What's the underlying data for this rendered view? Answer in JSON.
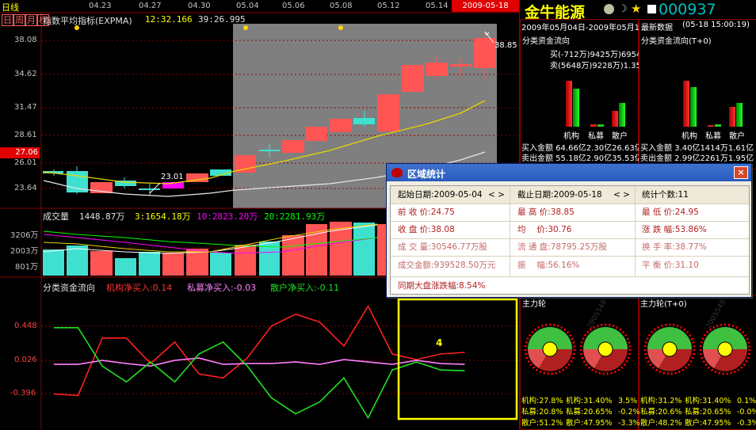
{
  "top_bar": {
    "period_tag": "日线",
    "period_tabs": [
      "日",
      "周",
      "月",
      "权"
    ],
    "dates": [
      "04.23",
      "04.27",
      "04.30",
      "05.04",
      "05.06",
      "05.08",
      "05.12",
      "05.14"
    ],
    "cursor_date": "2009-05-18",
    "indicator_label": "指数平均指标(EXPMA)",
    "indicator_val1": "12:32.166",
    "indicator_val2": "39:26.995"
  },
  "price_axis": [
    "38.08",
    "34.62",
    "31.47",
    "28.61",
    "26.01",
    "23.64"
  ],
  "price_current": "27.06",
  "price_high_label": "38.85",
  "price_low_label": "23.01",
  "volume": {
    "title": "成交量",
    "total": "1448.87万",
    "ma3": "3:1654.18万",
    "ma10": "10:2823.20万",
    "ma20": "20:2281.93万",
    "axis": [
      "3206万",
      "2003万",
      "801万"
    ]
  },
  "flow_chart": {
    "title": "分类资金流向",
    "inst": "机构净买入:0.14",
    "private": "私募净买入:-0.03",
    "retail": "散户净买入:-0.11",
    "axis": [
      "0.448",
      "0.026",
      "-0.396"
    ],
    "marker": "4",
    "inst_series": [
      -0.4,
      -0.42,
      0.3,
      0.3,
      -0.02,
      0.25,
      -0.15,
      -0.2,
      0.05,
      0.45,
      0.6,
      0.5,
      0.2,
      0.7,
      0.1,
      0.03,
      0.1,
      0.12
    ],
    "private_series": [
      -0.03,
      -0.03,
      0.02,
      -0.02,
      -0.05,
      0.02,
      0.05,
      -0.03,
      -0.02,
      -0.02,
      0.0,
      -0.03,
      0.03,
      0.0,
      -0.03,
      0.02,
      -0.02,
      -0.03
    ],
    "retail_series": [
      0.43,
      0.43,
      -0.05,
      -0.25,
      0.0,
      -0.25,
      0.1,
      0.25,
      -0.05,
      -0.45,
      -0.65,
      -0.5,
      -0.2,
      -0.7,
      -0.1,
      0.0,
      -0.1,
      -0.11
    ]
  },
  "right_panel": {
    "brand": "金牛能源",
    "stock_code": "000937",
    "date_range": "2009年05月04日-2009年05月18日",
    "latest_label": "最新数据",
    "latest_time": "(05-18 15:00:19)",
    "flow_title_left": "分类资金流向",
    "flow_title_right": "分类资金流向(T+0)",
    "buy_row": "买(-712万)9425万)6954万",
    "sell_row": "卖(5648万)9228万)1.35亿",
    "cat_labels": [
      "机构",
      "私募",
      "散户"
    ],
    "left_buy_amt": "买入金额 64.66亿2.30亿26.63亿",
    "left_sell_amt": "卖出金额 55.18亿2.90亿35.53亿",
    "right_buy_amt": "买入金额 3.40亿1414万1.61亿",
    "right_sell_amt": "卖出金额 2.99亿2261万1.95亿",
    "wheel_title_left": "主力轮",
    "wheel_title_right": "主力轮(T+0)",
    "watermark": "2005549",
    "pct_rows": [
      [
        "机构:27.8%",
        "机构:31.40%",
        "3.5%",
        "机构:31.2%",
        "机构:31.40%",
        "0.1%"
      ],
      [
        "私募:20.8%",
        "私募:20.65%",
        "-0.2%",
        "私募:20.6%",
        "私募:20.65%",
        "-0.0%"
      ],
      [
        "散户:51.2%",
        "散户:47.95%",
        "-3.3%",
        "散户:48.2%",
        "散户:47.95%",
        "-0.3%"
      ]
    ]
  },
  "dialog": {
    "title": "区域统计",
    "close": "×",
    "start_label": "起始日期:2009-05-04",
    "end_label": "截止日期:2009-05-18",
    "count_label": "统计个数:11",
    "prev_close": "前 收 价:24.75",
    "high": "最 高 价:38.85",
    "low": "最 低 价:24.95",
    "close_price": "收 盘 价:38.08",
    "avg": "均　 价:30.76",
    "change": "涨 跌 幅:53.86%",
    "volume": "成 交 量:30546.77万股",
    "float": "流 通 盘:78795.25万股",
    "turnover": "换 手 率:38.77%",
    "amount": "成交金额:939528.50万元",
    "amplitude": "振　 幅:56.16%",
    "balance": "平 衡 价:31.10",
    "market": "同期大盘涨跌幅:8.54%",
    "arrows": "< >"
  }
}
